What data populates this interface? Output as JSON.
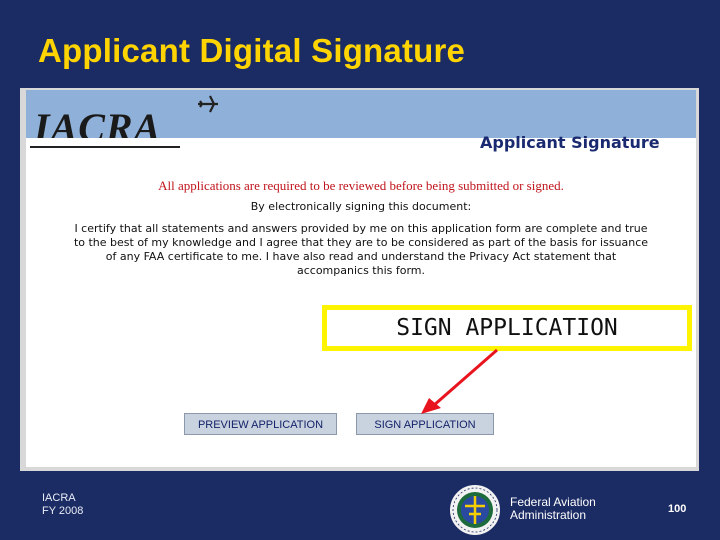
{
  "slide": {
    "title": "Applicant Digital Signature",
    "footer_left_line1": "IACRA",
    "footer_left_line2": "FY 2008",
    "faa_line1": "Federal Aviation",
    "faa_line2": "Administration",
    "page_number": "100",
    "seal_icon": "faa-seal-icon",
    "colors": {
      "background": "#1b2b63",
      "title": "#ffd400",
      "callout": "#fff400",
      "arrow": "#e8141e"
    }
  },
  "app": {
    "logo_text": "IACRA",
    "logo_icon": "airplane-icon",
    "header_title": "Applicant Signature",
    "warning": "All applications are required to be reviewed before being submitted or signed.",
    "by_signing": "By electronically signing this document:",
    "certification": {
      "line1": "I certify that all statements and answers provided by me on this application form are complete and true",
      "line2": "to the best of my knowledge and I agree that they are to be considered as part of the basis for issuance",
      "line3": "of any FAA certificate to me. I have also read and understand the Privacy Act statement that",
      "line4": "accompanics this form."
    },
    "buttons": {
      "preview": "PREVIEW APPLICATION",
      "sign": "SIGN APPLICATION"
    }
  },
  "callout": {
    "label": "SIGN APPLICATION"
  }
}
